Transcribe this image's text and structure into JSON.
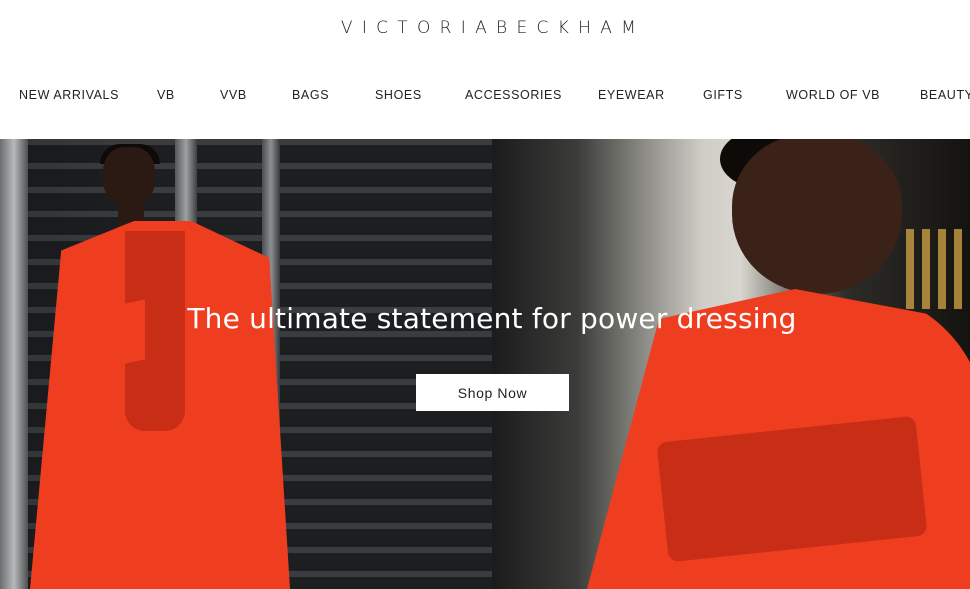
{
  "brand": {
    "logo_text": "VICTORIABECKHAM"
  },
  "nav": {
    "items": [
      {
        "label": "NEW ARRIVALS"
      },
      {
        "label": "VB"
      },
      {
        "label": "VVB"
      },
      {
        "label": "BAGS"
      },
      {
        "label": "SHOES"
      },
      {
        "label": "ACCESSORIES"
      },
      {
        "label": "EYEWEAR"
      },
      {
        "label": "GIFTS"
      },
      {
        "label": "WORLD OF VB"
      },
      {
        "label": "BEAUTY"
      }
    ]
  },
  "hero": {
    "headline": "The ultimate statement for power dressing",
    "cta_label": "Shop Now"
  },
  "colors": {
    "coat": "#ef3d20",
    "text": "#222222",
    "background": "#ffffff"
  }
}
